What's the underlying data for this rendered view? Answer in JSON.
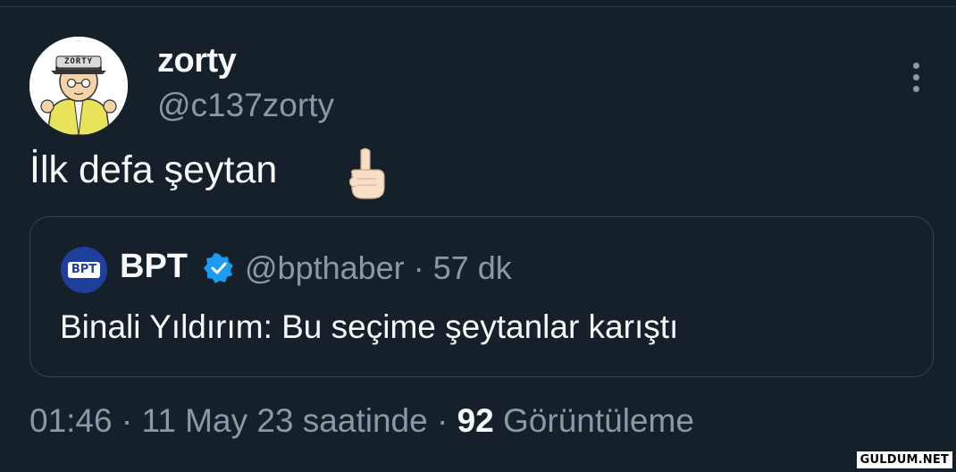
{
  "tweet": {
    "author_name": "zorty",
    "author_handle": "@c137zorty",
    "text": "İlk defa şeytan",
    "emoji": "pointing-up-hand",
    "avatar_lettering": "ZORTY"
  },
  "quote": {
    "author_name": "BPT",
    "avatar_lettering": "BPT",
    "verified": true,
    "author_handle": "@bpthaber",
    "separator": "·",
    "time_ago": "57 dk",
    "text": "Binali Yıldırım: Bu seçime şeytanlar karıştı"
  },
  "meta": {
    "time": "01:46",
    "date": "11 May 23 saatinde",
    "separator": "·",
    "views_count": "92",
    "views_label": "Görüntüleme"
  },
  "watermark": "GULDUM.NET",
  "colors": {
    "background": "#15202b",
    "primary_text": "#f7f9f9",
    "secondary_text": "#8b98a5",
    "border": "#38444d",
    "verified_badge": "#1d9bf0"
  },
  "icons": {
    "more": "more-vertical-icon",
    "verified": "verified-badge-icon"
  }
}
